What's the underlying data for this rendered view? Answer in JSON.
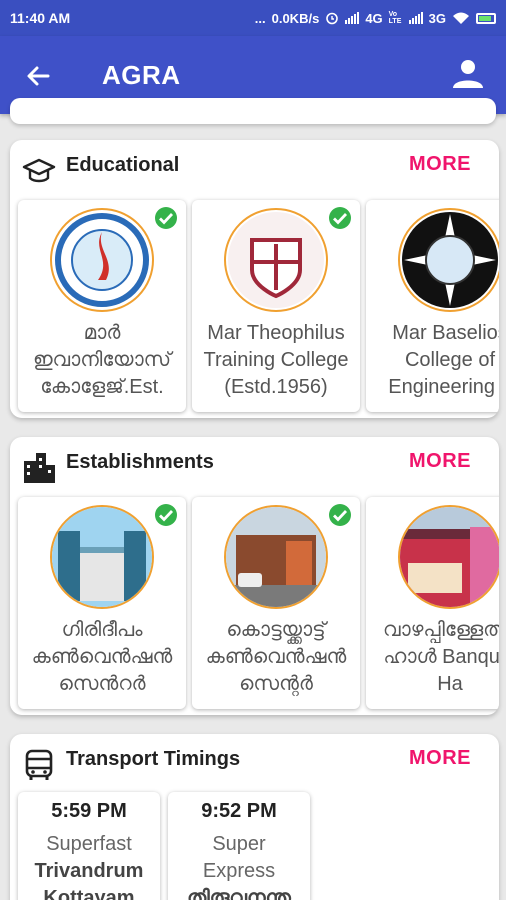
{
  "status_bar": {
    "time": "11:40 AM",
    "dots": "...",
    "speed": "0.0KB/s",
    "network1": "4G",
    "volte": "Vo LTE",
    "network2": "3G"
  },
  "app_bar": {
    "title": "AGRA",
    "back_icon": "arrow-back-icon",
    "account_icon": "person-icon"
  },
  "sections": {
    "educational": {
      "title": "Educational",
      "more": "MORE",
      "icon": "graduation-cap-icon",
      "items": [
        {
          "name": "മാർ ഇവാനിയോസ് കോളേജ്.Est.",
          "verified": true
        },
        {
          "name": "Mar Theophilus Training College (Estd.1956)",
          "verified": true
        },
        {
          "name": "Mar Baselios College of Engineering a",
          "verified": false
        }
      ]
    },
    "establishments": {
      "title": "Establishments",
      "more": "MORE",
      "icon": "buildings-icon",
      "items": [
        {
          "name": "ഗിരിദീപം കൺവെൻഷൻ സെൻറർ",
          "verified": true
        },
        {
          "name": "കൊട്ടയ്ക്കാട്ട് കൺവെൻഷൻ സെന്റർ",
          "verified": true
        },
        {
          "name": "വാഴപ്പിള്ളേത്ത് ഹാൾ Banquet Ha",
          "verified": false
        }
      ]
    },
    "transport": {
      "title": "Transport Timings",
      "more": "MORE",
      "icon": "bus-icon",
      "items": [
        {
          "time": "5:59 PM",
          "type": "Superfast",
          "route": "Trivandrum Kottayam"
        },
        {
          "time": "9:52 PM",
          "type": "Super Express",
          "route": "തിരുവനന്ത"
        }
      ]
    }
  },
  "colors": {
    "status_bar": "#3a4fc0",
    "app_bar": "#3f51c8",
    "accent": "#f0156c",
    "verified": "#34b24a",
    "logo_ring": "#f0a030"
  }
}
